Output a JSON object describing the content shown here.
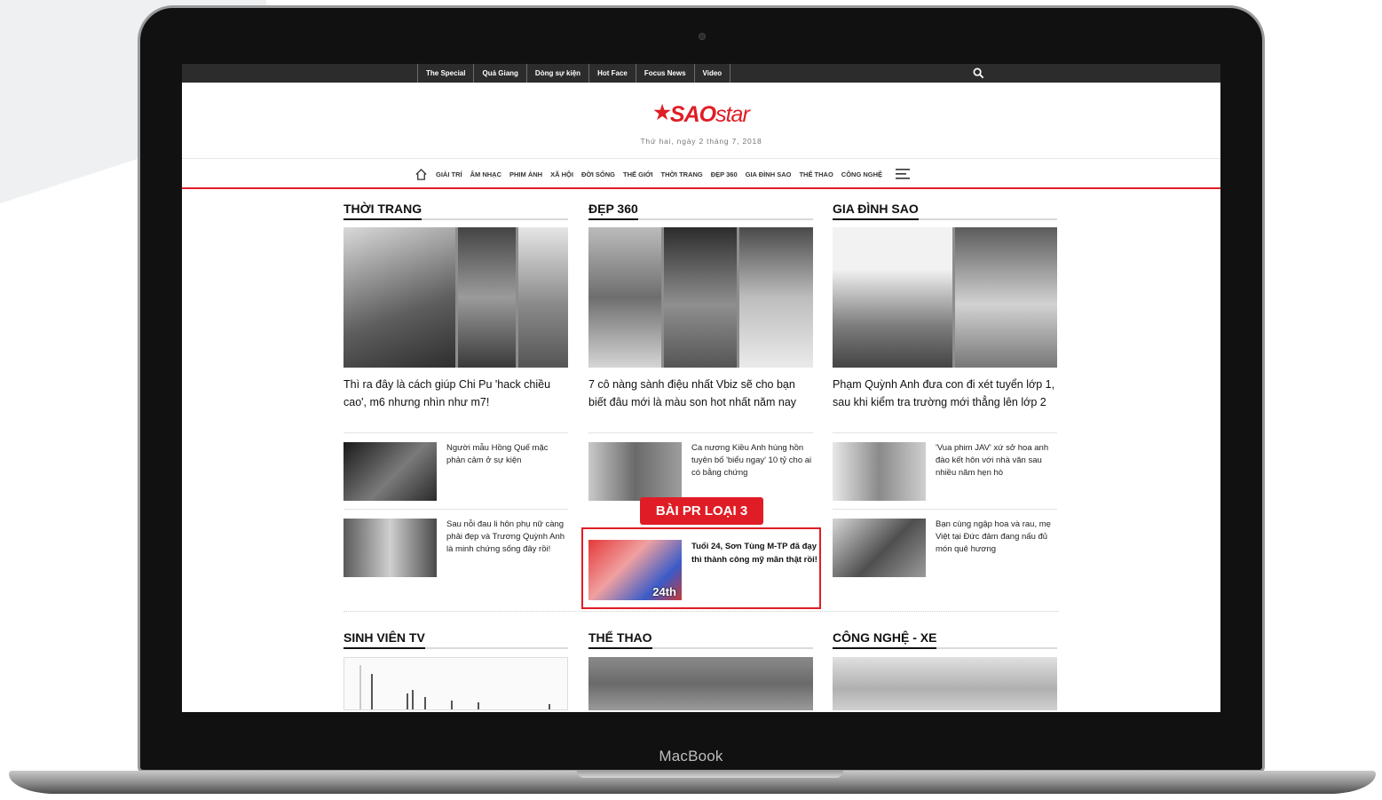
{
  "topbar": {
    "links": [
      "The Special",
      "Quả Giang",
      "Dòng sự kiện",
      "Hot Face",
      "Focus News",
      "Video"
    ]
  },
  "header": {
    "logo_main": "SAO",
    "logo_sub": "star",
    "date": "Thứ hai, ngày 2 tháng 7, 2018"
  },
  "nav": {
    "items": [
      "GIẢI TRÍ",
      "ÂM NHẠC",
      "PHIM ẢNH",
      "XÃ HỘI",
      "ĐỜI SỐNG",
      "THẾ GIỚI",
      "THỜI TRANG",
      "ĐẸP 360",
      "GIA ĐÌNH SAO",
      "THỂ THAO",
      "CÔNG NGHỆ"
    ]
  },
  "sections": [
    {
      "title": "THỜI TRANG",
      "headline": "Thì ra đây là cách giúp Chi Pu 'hack chiều cao', m6 nhưng nhìn như m7!",
      "items": [
        "Người mẫu Hồng Quế mặc phản cảm ở sự kiện",
        "Sau nỗi đau li hôn phụ nữ càng phải đẹp và Trương Quỳnh Anh là minh chứng sống đây rồi!"
      ]
    },
    {
      "title": "ĐẸP 360",
      "headline": "7 cô nàng sành điệu nhất Vbiz sẽ cho bạn biết đâu mới là màu son hot nhất năm nay",
      "items": [
        "Ca nương Kiều Anh hùng hồn tuyên bố 'biểu ngay' 10 tỷ cho ai có bằng chứng"
      ]
    },
    {
      "title": "GIA ĐÌNH SAO",
      "headline": "Phạm Quỳnh Anh đưa con đi xét tuyển lớp 1, sau khi kiểm tra trường mới thẳng lên lớp 2",
      "items": [
        "'Vua phim JAV' xứ sở hoa anh đào kết hôn với nhà văn sau nhiều năm hẹn hò",
        "Bạn cùng ngập hoa và rau, mẹ Việt tại Đức đảm đang nấu đủ món quê hương"
      ]
    }
  ],
  "pr": {
    "badge": "BÀI PR LOẠI 3",
    "title": "Tuổi 24, Sơn Tùng M-TP đã đạy thì thành công mỹ mãn thật rồi!",
    "thumb_text": "24th"
  },
  "bottom_sections": [
    "SINH VIÊN TV",
    "THỂ THAO",
    "CÔNG NGHỆ - XE"
  ],
  "device": {
    "label": "MacBook"
  },
  "colors": {
    "accent": "#e01d26",
    "topbar": "#2c2c2c"
  }
}
